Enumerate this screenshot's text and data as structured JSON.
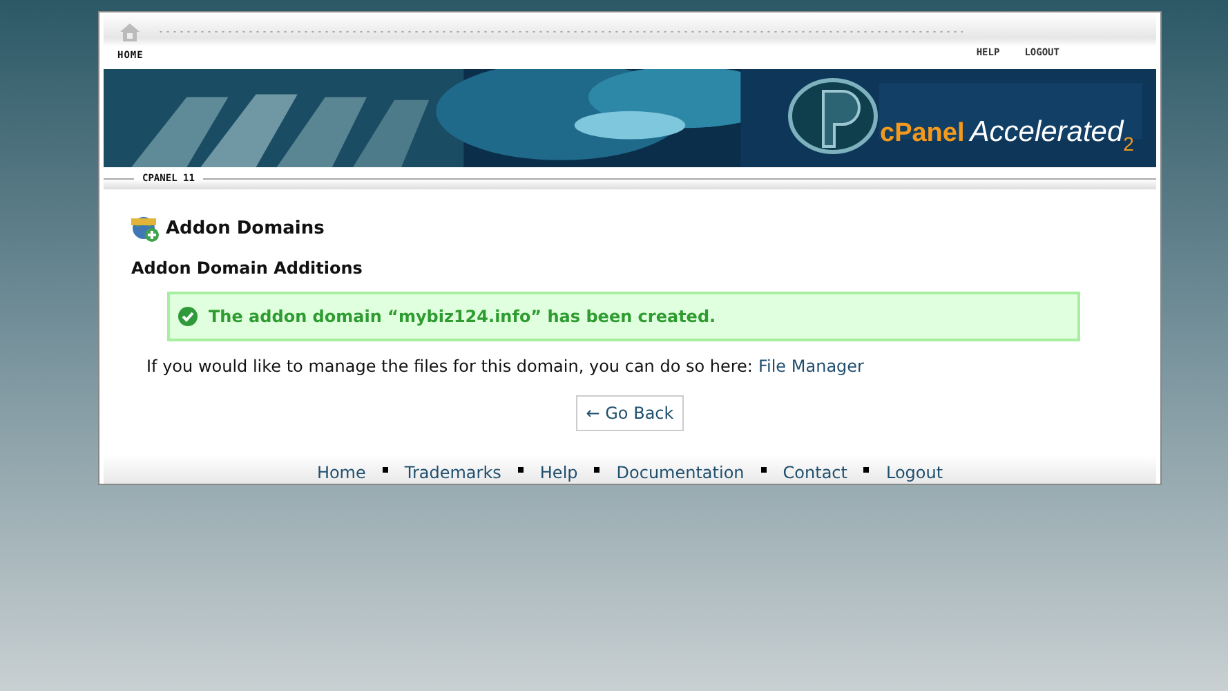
{
  "top_nav": {
    "home": "HOME",
    "links": [
      "HELP",
      "LOGOUT"
    ]
  },
  "banner": {
    "logo_brand": "cPanel",
    "logo_word": "Accelerated",
    "logo_sub": "2"
  },
  "version_label": "CPANEL 11",
  "page_title": "Addon Domains",
  "section_title": "Addon Domain Additions",
  "success_message": "The addon domain “mybiz124.info” has been created.",
  "info_text": "If you would like to manage the files for this domain, you can do so here:",
  "info_link": "File Manager",
  "back_button": "← Go Back",
  "footer_links": [
    "Home",
    "Trademarks",
    "Help",
    "Documentation",
    "Contact",
    "Logout"
  ]
}
